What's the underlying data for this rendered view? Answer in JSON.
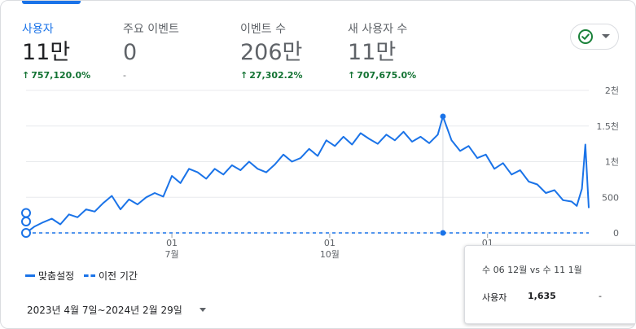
{
  "metrics": [
    {
      "label": "사용자",
      "value": "11만",
      "change": "757,120.0%",
      "active": true
    },
    {
      "label": "주요 이벤트",
      "value": "0",
      "change": "-",
      "active": false
    },
    {
      "label": "이벤트 수",
      "value": "206만",
      "change": "27,302.2%",
      "active": false
    },
    {
      "label": "새 사용자 수",
      "value": "11만",
      "change": "707,675.0%",
      "active": false
    }
  ],
  "legend": {
    "current": "맞춤설정",
    "previous": "이전 기간"
  },
  "date_range": "2023년 4월 7일~2024년 2월 29일",
  "tooltip": {
    "title": "수 06 12월 vs 수 11 1월",
    "metric": "사용자",
    "value": "1,635",
    "previous": "-"
  },
  "colors": {
    "accent": "#1a73e8",
    "positive": "#137333",
    "grid": "#e8eaed"
  },
  "icons": {
    "status": "check-circle-icon",
    "dropdown": "chevron-down-icon",
    "next": "chevron-right-icon"
  },
  "chart_data": {
    "type": "line",
    "x_tick_labels": [
      {
        "day": "01",
        "month": "7월"
      },
      {
        "day": "01",
        "month": "10월"
      },
      {
        "day": "01",
        "month": ""
      }
    ],
    "y_tick_labels": [
      "0",
      "500",
      "1천",
      "1.5천",
      "2천"
    ],
    "ylim": [
      0,
      2000
    ],
    "grid": true,
    "legend_position": "bottom-left",
    "series": [
      {
        "name": "맞춤설정",
        "style": "solid",
        "x": [
          "2023-04-07",
          "2023-04-12",
          "2023-04-17",
          "2023-04-22",
          "2023-04-27",
          "2023-05-02",
          "2023-05-07",
          "2023-05-12",
          "2023-05-17",
          "2023-05-22",
          "2023-05-27",
          "2023-06-01",
          "2023-06-06",
          "2023-06-11",
          "2023-06-16",
          "2023-06-21",
          "2023-06-26",
          "2023-07-01",
          "2023-07-06",
          "2023-07-11",
          "2023-07-16",
          "2023-07-21",
          "2023-07-26",
          "2023-07-31",
          "2023-08-05",
          "2023-08-10",
          "2023-08-15",
          "2023-08-20",
          "2023-08-25",
          "2023-08-30",
          "2023-09-04",
          "2023-09-09",
          "2023-09-14",
          "2023-09-19",
          "2023-09-24",
          "2023-09-29",
          "2023-10-04",
          "2023-10-09",
          "2023-10-14",
          "2023-10-19",
          "2023-10-24",
          "2023-10-29",
          "2023-11-03",
          "2023-11-08",
          "2023-11-13",
          "2023-11-18",
          "2023-11-23",
          "2023-11-28",
          "2023-12-03",
          "2023-12-06",
          "2023-12-11",
          "2023-12-16",
          "2023-12-21",
          "2023-12-26",
          "2023-12-31",
          "2024-01-05",
          "2024-01-10",
          "2024-01-15",
          "2024-01-20",
          "2024-01-25",
          "2024-01-30",
          "2024-02-04",
          "2024-02-09",
          "2024-02-14",
          "2024-02-19",
          "2024-02-22",
          "2024-02-25",
          "2024-02-27",
          "2024-02-29"
        ],
        "values": [
          1,
          90,
          150,
          200,
          120,
          260,
          220,
          330,
          300,
          420,
          520,
          330,
          470,
          400,
          500,
          560,
          510,
          800,
          700,
          900,
          850,
          760,
          900,
          820,
          950,
          880,
          1000,
          900,
          850,
          960,
          1100,
          1000,
          1050,
          1180,
          1080,
          1300,
          1220,
          1350,
          1240,
          1400,
          1320,
          1250,
          1380,
          1300,
          1420,
          1280,
          1350,
          1260,
          1380,
          1635,
          1300,
          1150,
          1220,
          1050,
          1100,
          900,
          980,
          820,
          880,
          720,
          680,
          560,
          600,
          460,
          440,
          380,
          620,
          1240,
          350
        ]
      },
      {
        "name": "이전 기간",
        "style": "dashed",
        "x": [
          "2023-04-07",
          "2023-12-06",
          "2024-02-29"
        ],
        "values": [
          0,
          0,
          0
        ]
      }
    ]
  }
}
